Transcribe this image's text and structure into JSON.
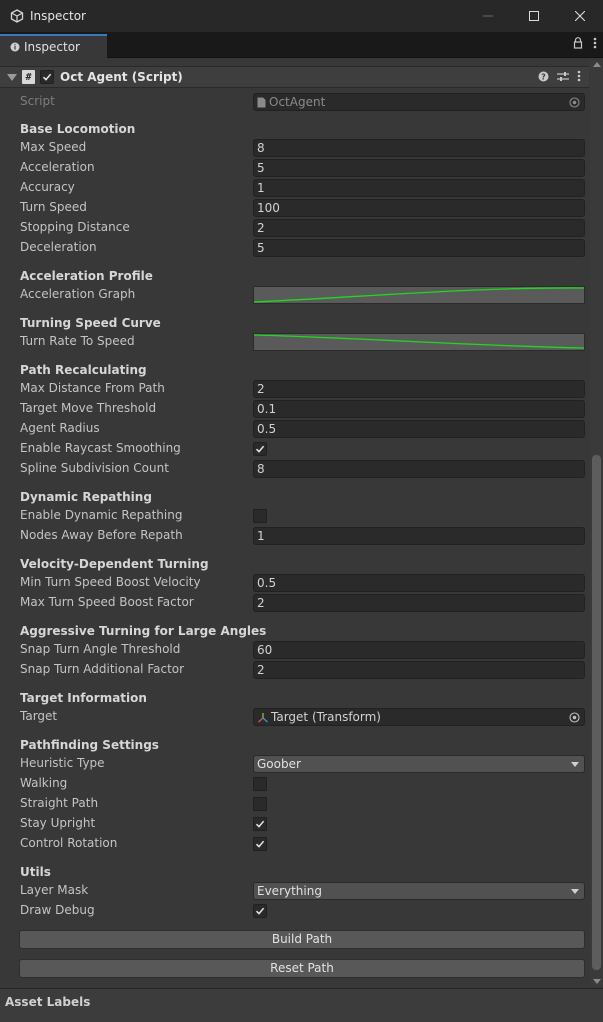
{
  "window": {
    "title": "Inspector"
  },
  "tab": {
    "label": "Inspector"
  },
  "component": {
    "title": "Oct Agent (Script)",
    "enabled": true
  },
  "script": {
    "label": "Script",
    "value": "OctAgent"
  },
  "sections": {
    "base_locomotion": "Base Locomotion",
    "acceleration_profile": "Acceleration Profile",
    "turning_speed_curve": "Turning Speed Curve",
    "path_recalculating": "Path Recalculating",
    "dynamic_repathing": "Dynamic Repathing",
    "velocity_turning": "Velocity-Dependent Turning",
    "aggressive_turning": "Aggressive Turning for Large Angles",
    "target_information": "Target Information",
    "pathfinding_settings": "Pathfinding Settings",
    "utils": "Utils"
  },
  "fields": {
    "max_speed": {
      "label": "Max Speed",
      "value": "8"
    },
    "acceleration": {
      "label": "Acceleration",
      "value": "5"
    },
    "accuracy": {
      "label": "Accuracy",
      "value": "1"
    },
    "turn_speed": {
      "label": "Turn Speed",
      "value": "100"
    },
    "stopping_distance": {
      "label": "Stopping Distance",
      "value": "2"
    },
    "deceleration": {
      "label": "Deceleration",
      "value": "5"
    },
    "acceleration_graph": {
      "label": "Acceleration Graph"
    },
    "turn_rate_to_speed": {
      "label": "Turn Rate To Speed"
    },
    "max_distance_from_path": {
      "label": "Max Distance From Path",
      "value": "2"
    },
    "target_move_threshold": {
      "label": "Target Move Threshold",
      "value": "0.1"
    },
    "agent_radius": {
      "label": "Agent Radius",
      "value": "0.5"
    },
    "enable_raycast_smoothing": {
      "label": "Enable Raycast Smoothing",
      "checked": true
    },
    "spline_subdivision_count": {
      "label": "Spline Subdivision Count",
      "value": "8"
    },
    "enable_dynamic_repathing": {
      "label": "Enable Dynamic Repathing",
      "checked": false
    },
    "nodes_away_before_repath": {
      "label": "Nodes Away Before Repath",
      "value": "1"
    },
    "min_turn_speed_boost_velocity": {
      "label": "Min Turn Speed Boost Velocity",
      "value": "0.5"
    },
    "max_turn_speed_boost_factor": {
      "label": "Max Turn Speed Boost Factor",
      "value": "2"
    },
    "snap_turn_angle_threshold": {
      "label": "Snap Turn Angle Threshold",
      "value": "60"
    },
    "snap_turn_additional_factor": {
      "label": "Snap Turn Additional Factor",
      "value": "2"
    },
    "target": {
      "label": "Target",
      "value": "Target (Transform)"
    },
    "heuristic_type": {
      "label": "Heuristic Type",
      "value": "Goober"
    },
    "walking": {
      "label": "Walking",
      "checked": false
    },
    "straight_path": {
      "label": "Straight Path",
      "checked": false
    },
    "stay_upright": {
      "label": "Stay Upright",
      "checked": true
    },
    "control_rotation": {
      "label": "Control Rotation",
      "checked": true
    },
    "layer_mask": {
      "label": "Layer Mask",
      "value": "Everything"
    },
    "draw_debug": {
      "label": "Draw Debug",
      "checked": true
    }
  },
  "buttons": {
    "build_path": "Build Path",
    "reset_path": "Reset Path"
  },
  "footer": {
    "asset_labels": "Asset Labels"
  },
  "colors": {
    "curve_green": "#20d820",
    "tab_accent": "#3a79bb"
  }
}
